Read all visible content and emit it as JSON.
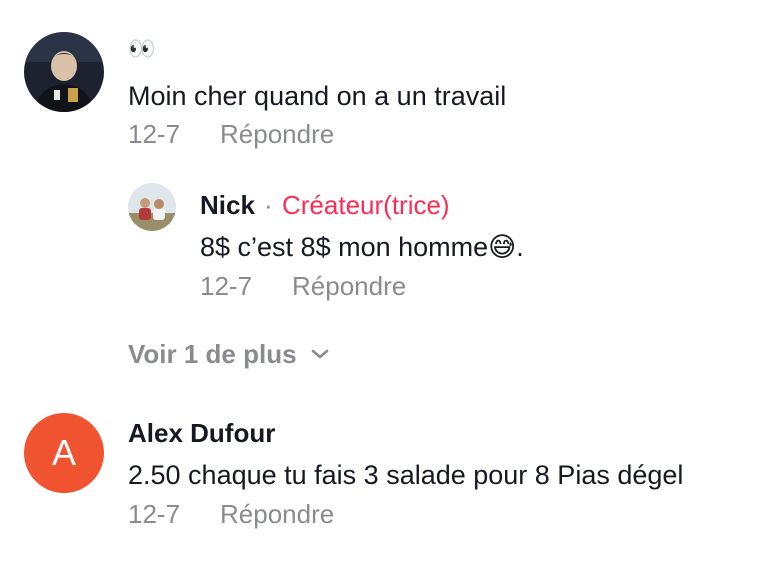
{
  "comments": [
    {
      "avatar": "user-photo-avatar",
      "emoji": "👀",
      "text": "Moin cher quand on a un travail",
      "date": "12-7",
      "reply_label": "Répondre"
    },
    {
      "avatar": "user-photo-avatar",
      "username": "Nick",
      "separator": "·",
      "badge": "Créateur(trice)",
      "text": "8$ c’est 8$ mon homme😅.",
      "date": "12-7",
      "reply_label": "Répondre"
    },
    {
      "avatar_initial": "A",
      "username": "Alex Dufour",
      "text": "2.50 chaque tu fais 3 salade pour 8 Pias dégel",
      "date": "12-7",
      "reply_label": "Répondre"
    }
  ],
  "view_more": {
    "label": "Voir 1 de plus",
    "icon": "chevron-down-icon"
  },
  "colors": {
    "creator_badge": "#fe2c55",
    "meta_text": "#8a8b91",
    "initial_avatar_bg": "#f0532f"
  }
}
